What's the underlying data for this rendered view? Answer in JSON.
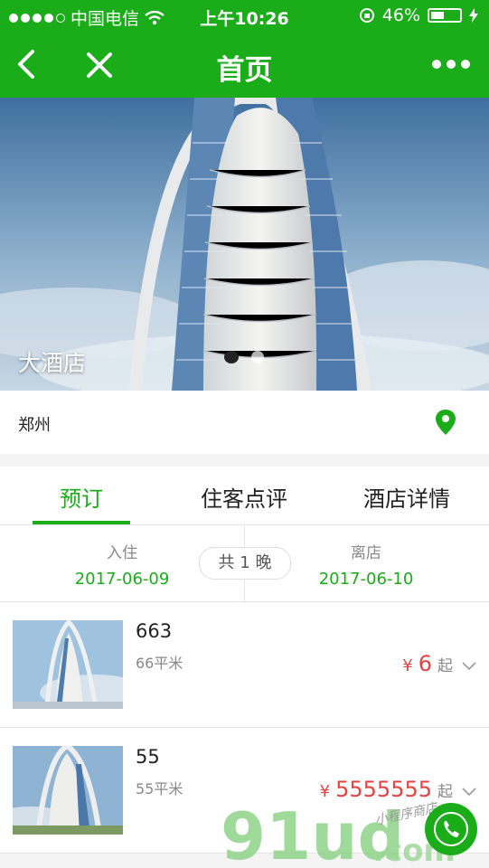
{
  "status_bar": {
    "carrier": "中国电信",
    "time": "上午10:26",
    "battery_percent": "46%",
    "battery_level": 0.46
  },
  "navbar": {
    "title": "首页"
  },
  "hero": {
    "hotel_name": "大酒店",
    "slide_count": 2,
    "active_slide": 1
  },
  "location": {
    "city": "郑州"
  },
  "tabs": [
    {
      "label": "预订",
      "active": true
    },
    {
      "label": "住客点评",
      "active": false
    },
    {
      "label": "酒店详情",
      "active": false
    }
  ],
  "dates": {
    "checkin_label": "入住",
    "checkin_value": "2017-06-09",
    "nights_label": "共 1 晚",
    "checkout_label": "离店",
    "checkout_value": "2017-06-10"
  },
  "rooms": [
    {
      "name": "663",
      "area": "66平米",
      "currency": "¥",
      "price": "6",
      "suffix": "起"
    },
    {
      "name": "55",
      "area": "55平米",
      "currency": "¥",
      "price": "5555555",
      "suffix": "起"
    }
  ],
  "watermark": {
    "brand": "91ud.com",
    "tagline": "小程序商店"
  },
  "colors": {
    "brand_green": "#1aad19",
    "price_red": "#e64340"
  }
}
